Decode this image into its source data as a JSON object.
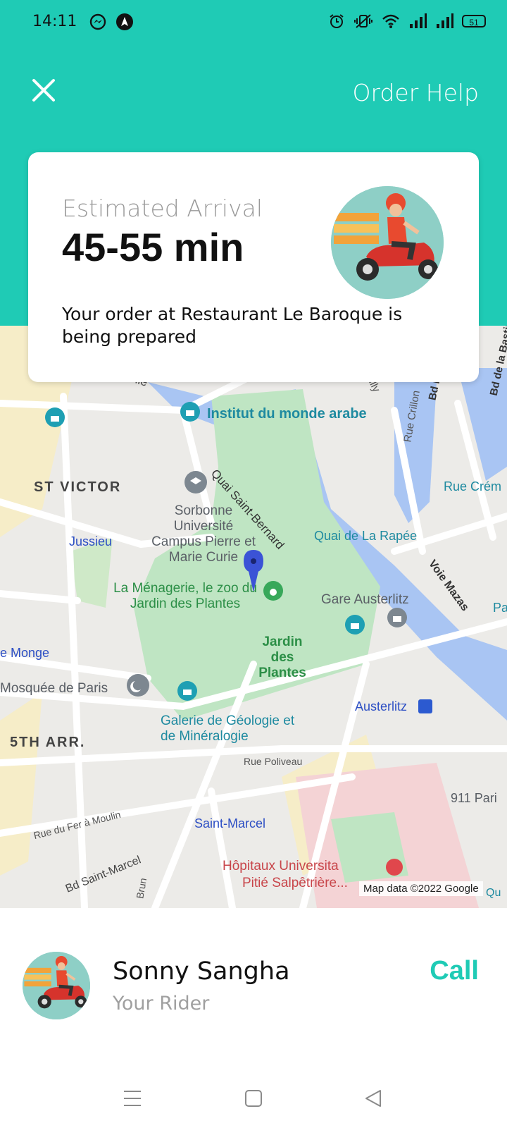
{
  "status_bar": {
    "time": "14:11",
    "battery": "51",
    "left_icons": [
      "messenger-icon",
      "nav-app-icon"
    ],
    "right_icons": [
      "alarm-icon",
      "vibrate-icon",
      "wifi-icon",
      "signal-icon",
      "signal-icon"
    ]
  },
  "header": {
    "close_icon": "close-icon",
    "help_label": "Order Help",
    "accent_color": "#1fcbb5"
  },
  "eta_card": {
    "label": "Estimated Arrival",
    "value": "45-55 min",
    "status": "Your order at Restaurant Le Baroque is being prepared"
  },
  "map": {
    "attribution": "Map data ©2022 Google",
    "labels": {
      "tournelle": "ournelle",
      "institut": "Institut du monde arabe",
      "quai_saint_bernard": "Quai Saint-Bernard",
      "sully": "Sully",
      "rue_crillon": "Rue Crillon",
      "bd_b": "Bd B",
      "bd_bastille": "Bd de la Bastil",
      "st_victor": "ST VICTOR",
      "rue_crem": "Rue Crém",
      "sorbonne": "Sorbonne Université Campus Pierre et Marie Curie",
      "jussieu": "Jussieu",
      "quai_rapee": "Quai de La Rapée",
      "voie_mazas": "Voie Mazas",
      "menagerie": "La Ménagerie, le zoo du Jardin des Plantes",
      "gare_austerlitz": "Gare Austerlitz",
      "pa": "Pa",
      "jardin": "Jardin des Plantes",
      "monge": "e Monge",
      "mosquee": "Mosquée de Paris",
      "austerlitz": "Austerlitz",
      "galerie": "Galerie de Géologie et de Minéralogie",
      "fifth": "5TH ARR.",
      "rue_poliveau": "Rue Poliveau",
      "pari_911": "911 Pari",
      "rue_fer": "Rue du Fer à Moulin",
      "saint_marcel": "Saint-Marcel",
      "bd_saint_marcel": "Bd Saint-Marcel",
      "brun": "Brun",
      "hopitaux": "Hôpitaux Universita",
      "pitie": "Pitié Salpêtrière...",
      "qu": "Qu"
    }
  },
  "rider": {
    "name": "Sonny Sangha",
    "role": "Your Rider",
    "call_label": "Call"
  },
  "nav_bar": {
    "buttons": [
      "menu-icon",
      "home-icon",
      "back-icon"
    ]
  }
}
